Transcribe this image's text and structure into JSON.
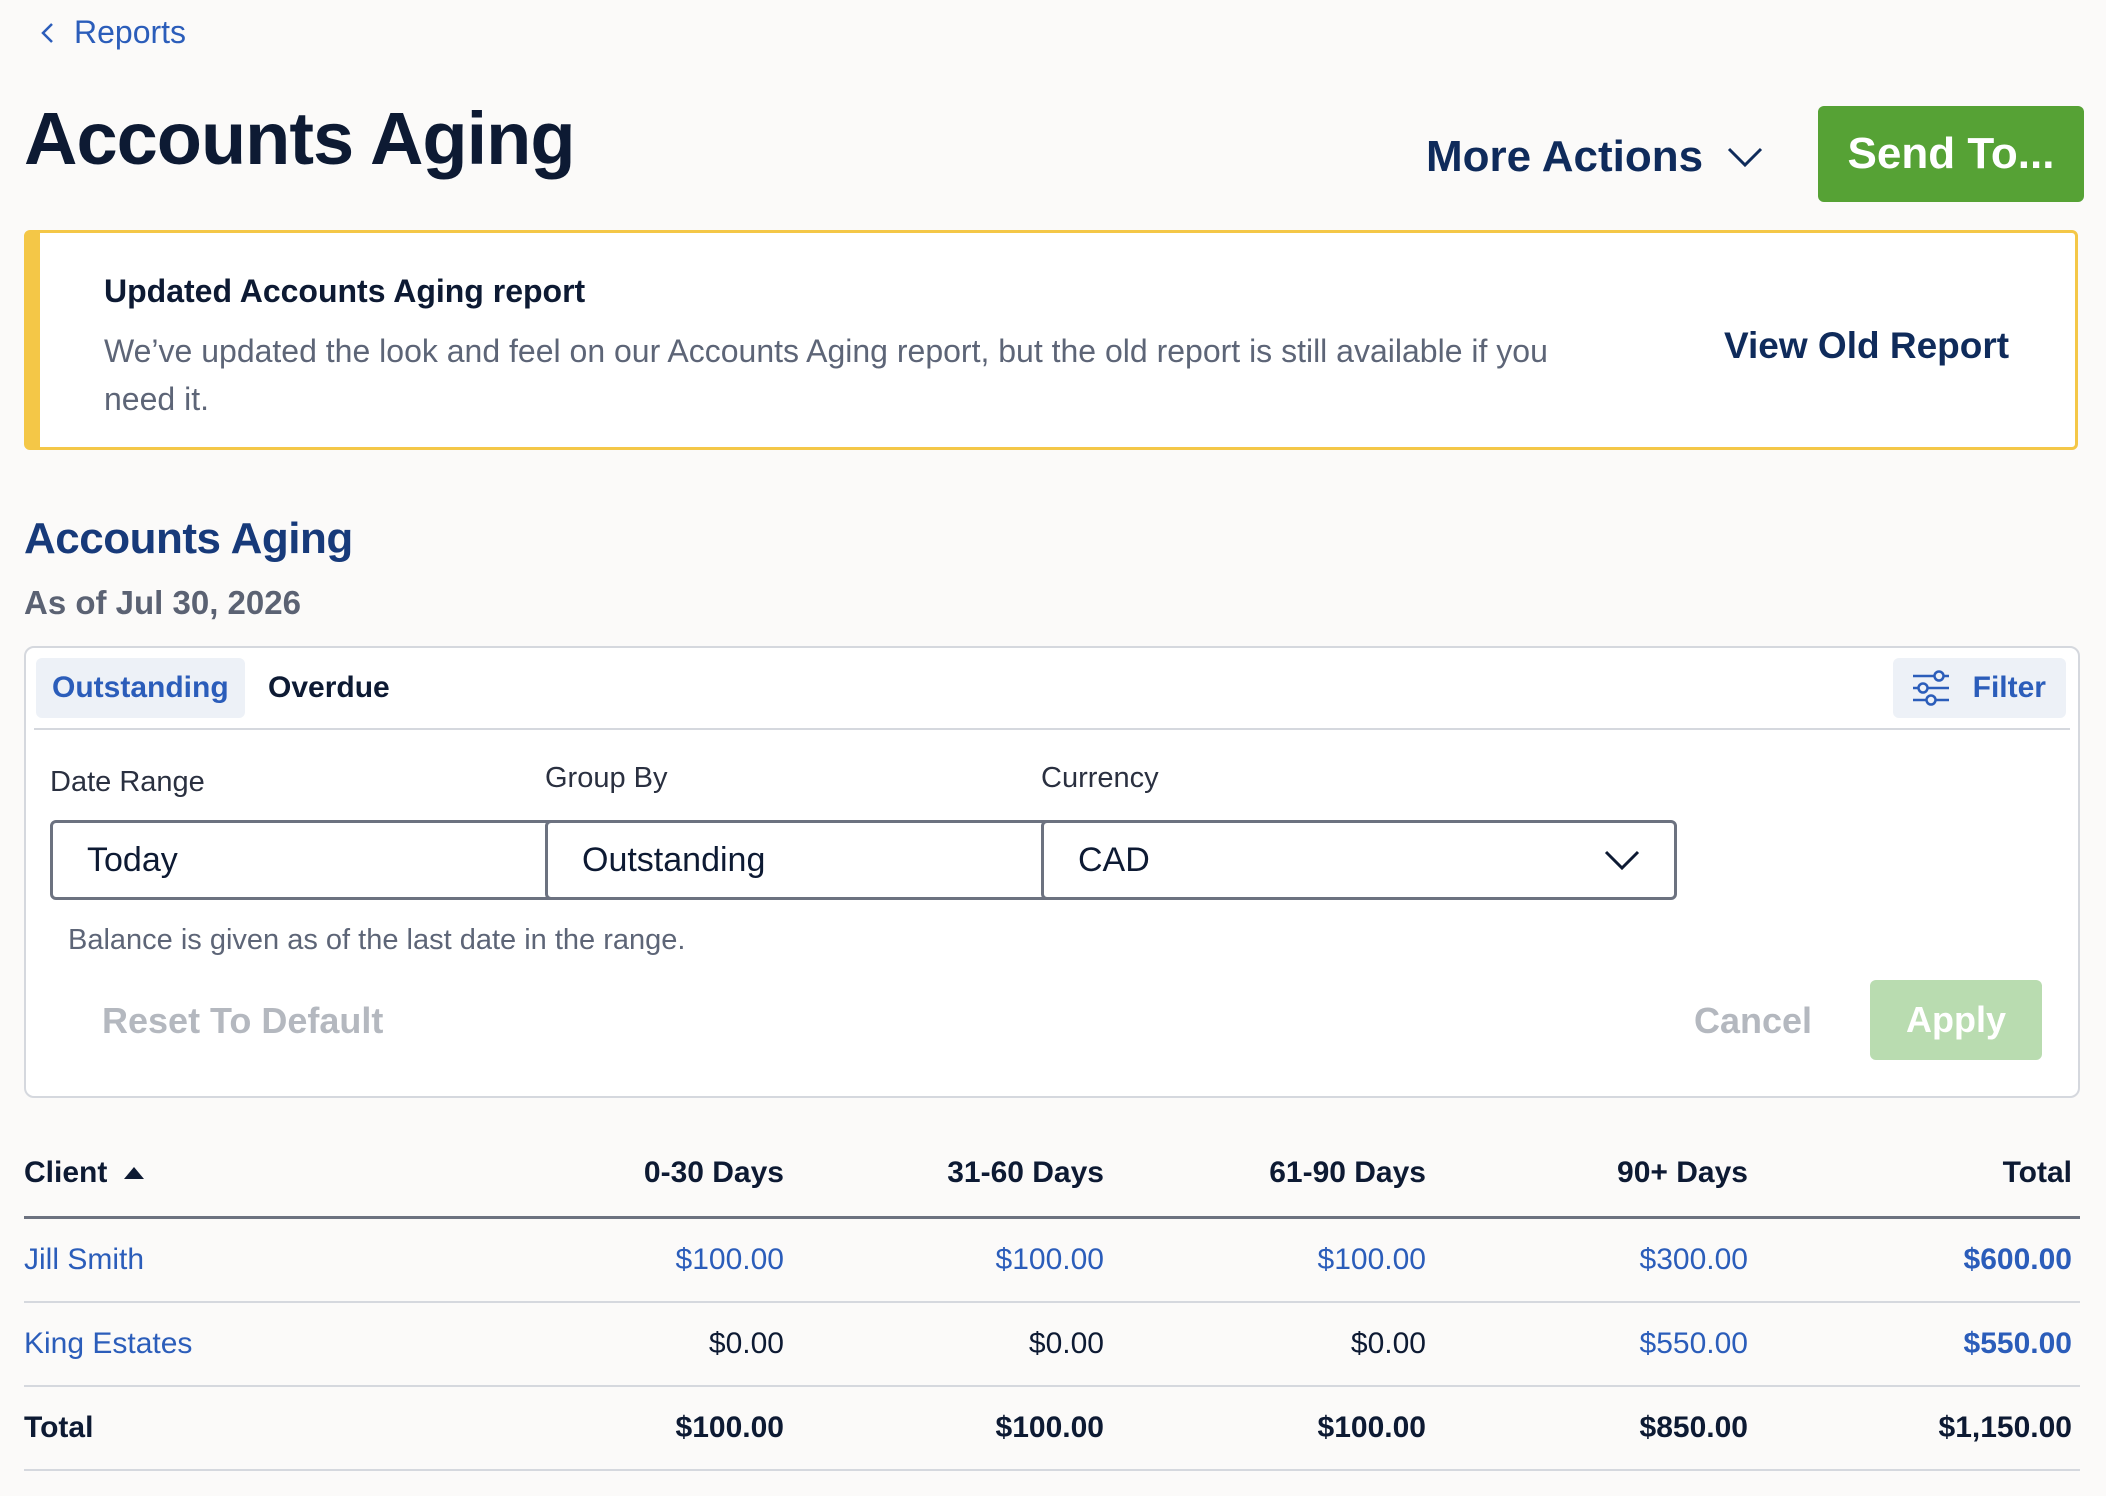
{
  "breadcrumb": {
    "label": "Reports"
  },
  "header": {
    "title": "Accounts Aging",
    "more_actions_label": "More Actions",
    "send_to_label": "Send To..."
  },
  "banner": {
    "title": "Updated Accounts Aging report",
    "body": "We’ve updated the look and feel on our Accounts Aging report, but the old report is still available if you need it.",
    "link_label": "View Old Report"
  },
  "report": {
    "title": "Accounts Aging",
    "as_of": "As of Jul 30, 2026"
  },
  "filters": {
    "tabs": [
      {
        "label": "Outstanding",
        "active": true
      },
      {
        "label": "Overdue",
        "active": false
      }
    ],
    "filter_button_label": "Filter",
    "date_range": {
      "label": "Date Range",
      "value": "Today"
    },
    "group_by": {
      "label": "Group By",
      "value": "Outstanding"
    },
    "currency": {
      "label": "Currency",
      "value": "CAD"
    },
    "hint": "Balance is given as of the last date in the range.",
    "reset_label": "Reset To Default",
    "cancel_label": "Cancel",
    "apply_label": "Apply"
  },
  "table": {
    "columns": [
      "Client",
      "0-30 Days",
      "31-60 Days",
      "61-90 Days",
      "90+ Days",
      "Total"
    ],
    "rows": [
      {
        "client": "Jill Smith",
        "d0_30": "$100.00",
        "d31_60": "$100.00",
        "d61_90": "$100.00",
        "d90": "$300.00",
        "total": "$600.00"
      },
      {
        "client": "King Estates",
        "d0_30": "$0.00",
        "d31_60": "$0.00",
        "d61_90": "$0.00",
        "d90": "$550.00",
        "total": "$550.00"
      }
    ],
    "totals": {
      "label": "Total",
      "d0_30": "$100.00",
      "d31_60": "$100.00",
      "d61_90": "$100.00",
      "d90": "$850.00",
      "total": "$1,150.00"
    }
  },
  "colors": {
    "brand_green": "#56a235",
    "link_blue": "#2b5dba",
    "navy": "#0f2b5b",
    "banner_yellow": "#f4c747"
  }
}
